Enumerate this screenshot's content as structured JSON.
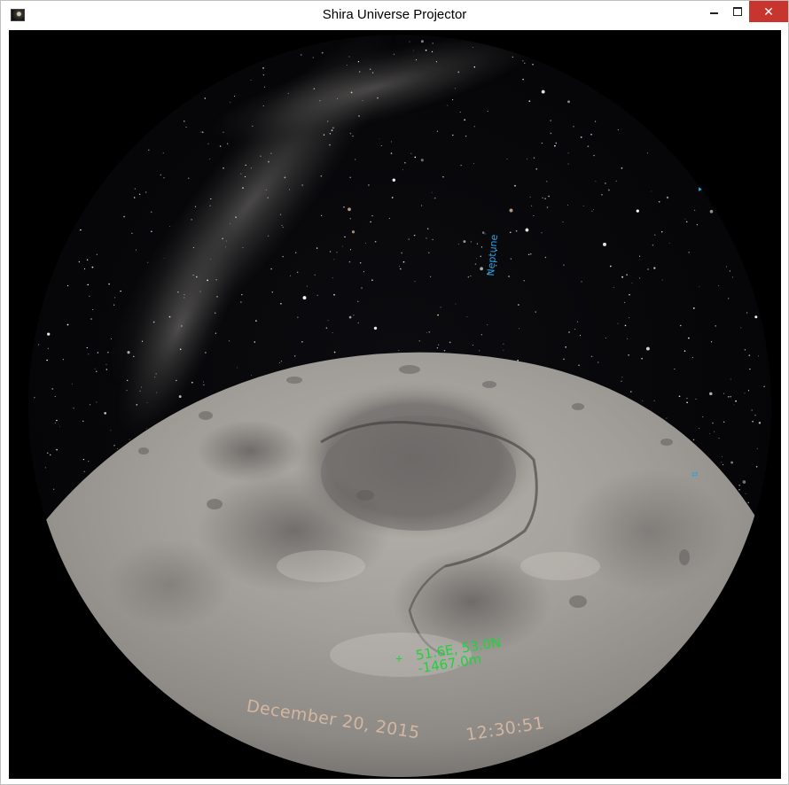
{
  "window": {
    "title": "Shira Universe Projector",
    "controls": {
      "minimize": "minimize",
      "maximize": "maximize",
      "close": "✕"
    }
  },
  "sky": {
    "planet_labels": [
      "Neptune"
    ]
  },
  "surface_readout": {
    "coordinates": "51.6E, 53.0N",
    "elevation": "-1467.0m",
    "marker": "+"
  },
  "overlay": {
    "date": "December 20, 2015",
    "time": "12:30:51"
  },
  "colors": {
    "planet_label": "#2aa3e6",
    "readout": "#1fd33a",
    "datetime": "#d7b9a4",
    "close_button": "#c7352e"
  },
  "icons": {
    "app": "planetarium-app-icon",
    "minimize": "minimize-icon",
    "maximize": "maximize-icon",
    "close": "close-icon"
  }
}
